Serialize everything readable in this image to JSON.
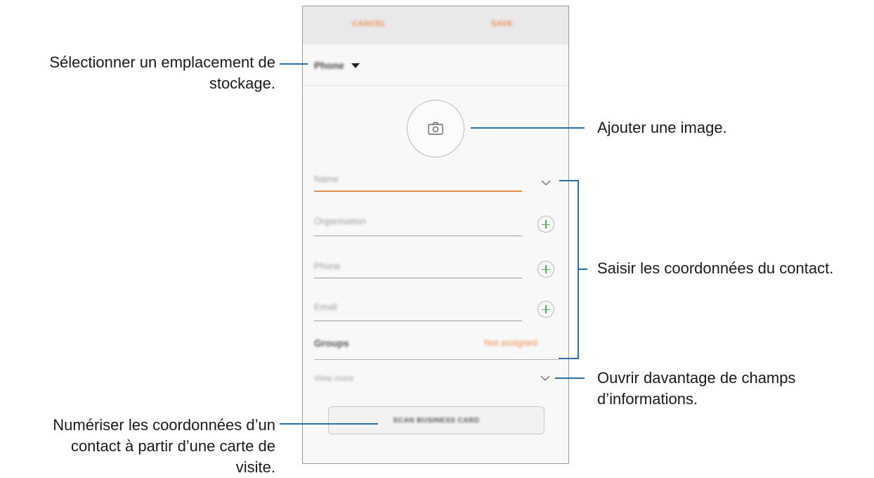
{
  "screen": {
    "topbar": {
      "cancel_label": "CANCEL",
      "save_label": "SAVE"
    },
    "storage": {
      "label": "Phone"
    },
    "fields": {
      "name_placeholder": "Name",
      "organisation_placeholder": "Organisation",
      "phone_placeholder": "Phone",
      "email_placeholder": "Email"
    },
    "groups": {
      "label": "Groups",
      "value": "Not assigned"
    },
    "view_more_label": "View more",
    "scan_button_label": "SCAN BUSINESS CARD",
    "icons": {
      "camera": "camera-icon",
      "dropdown": "triangle-down-icon",
      "expand": "chevron-down-icon",
      "add": "plus-icon"
    },
    "colors": {
      "accent": "#f08a4b",
      "add_icon": "#4caf50",
      "leader_line": "#2a6fa8"
    }
  },
  "callouts": {
    "storage_line1": "Sélectionner un emplacement de",
    "storage_line2": "stockage.",
    "image": "Ajouter une image.",
    "contact_info": "Saisir les coordonnées du contact.",
    "more_fields_line1": "Ouvrir davantage de champs",
    "more_fields_line2": "d’informations.",
    "scan_line1": "Numériser les coordonnées d’un",
    "scan_line2": "contact à partir d’une carte de",
    "scan_line3": "visite."
  }
}
